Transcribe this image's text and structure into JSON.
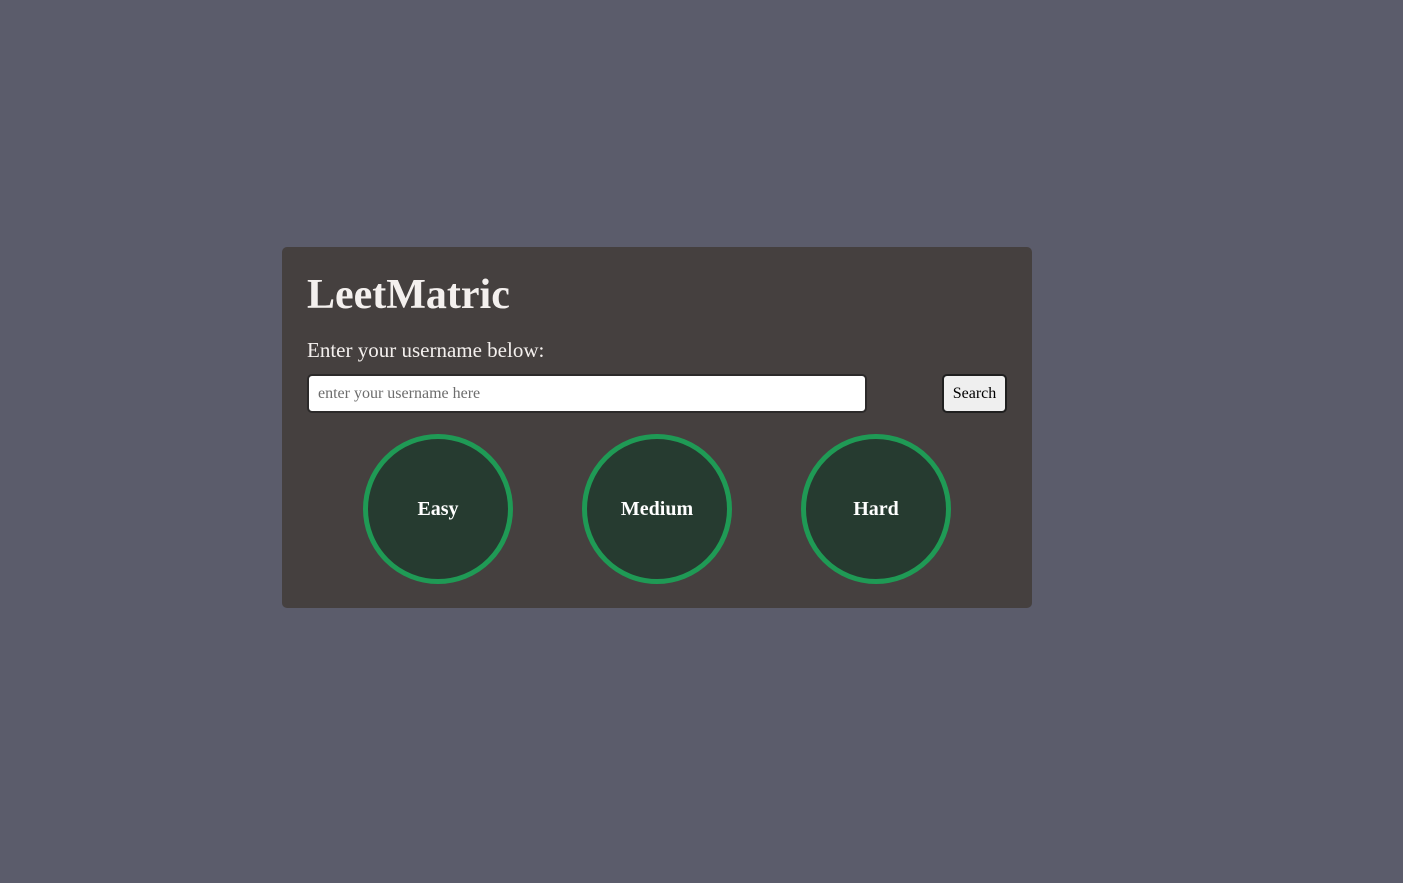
{
  "app": {
    "title": "LeetMatric",
    "prompt": "Enter your username below:"
  },
  "search": {
    "placeholder": "enter your username here",
    "value": "",
    "button_label": "Search"
  },
  "progress": {
    "items": [
      {
        "label": "Easy"
      },
      {
        "label": "Medium"
      },
      {
        "label": "Hard"
      }
    ]
  },
  "colors": {
    "page_background": "#5b5c6b",
    "card_background": "#45403f",
    "circle_fill": "#263b30",
    "circle_border": "#1f9a55",
    "text": "#f4f0ee"
  }
}
